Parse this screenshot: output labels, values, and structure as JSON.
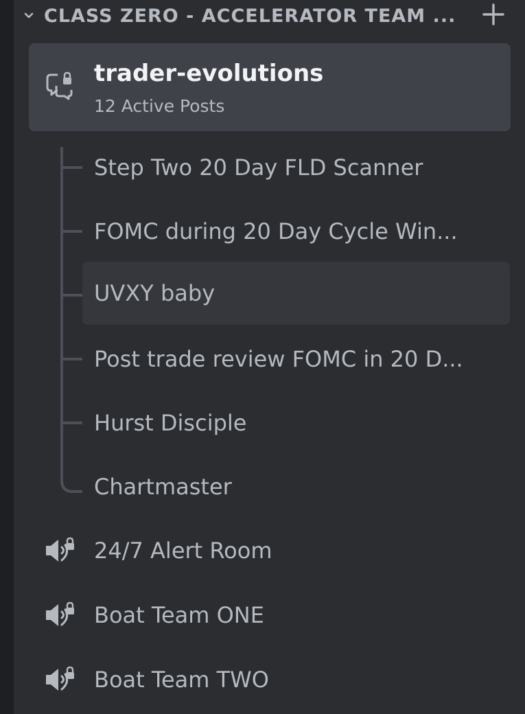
{
  "category": {
    "title": "CLASS ZERO - ACCELERATOR TEAM ...",
    "collapse_icon": "chevron-down-icon",
    "add_icon": "plus-icon"
  },
  "forum_channel": {
    "icon": "forum-lock-icon",
    "name": "trader-evolutions",
    "subtitle": "12 Active Posts"
  },
  "threads": [
    {
      "label": "Step Two 20 Day FLD Scanner"
    },
    {
      "label": "FOMC during 20 Day Cycle Win..."
    },
    {
      "label": "UVXY baby",
      "highlighted": true
    },
    {
      "label": "Post trade review FOMC in 20 D..."
    },
    {
      "label": "Hurst Disciple"
    },
    {
      "label": "Chartmaster"
    }
  ],
  "voice_channels": [
    {
      "icon": "voice-lock-icon",
      "label": "24/7 Alert Room"
    },
    {
      "icon": "voice-lock-icon",
      "label": "Boat Team ONE"
    },
    {
      "icon": "voice-lock-icon",
      "label": "Boat Team TWO"
    }
  ],
  "colors": {
    "background": "#2b2d31",
    "selected": "#404249",
    "hover": "#35373c",
    "text_muted": "#b5bac1",
    "text_bright": "#f2f3f5"
  }
}
